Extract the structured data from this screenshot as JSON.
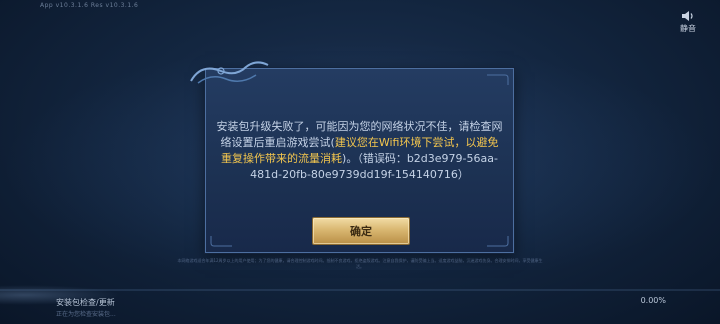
{
  "header": {
    "version": "App v10.3.1.6 Res v10.3.1.6",
    "mute_label": "静音"
  },
  "dialog": {
    "message_part1": "安装包升级失败了，可能因为您的网络状况不佳，请检查网络设置后重启游戏尝试(",
    "message_highlight": "建议您在Wifi环境下尝试，以避免重复操作带来的流量消耗",
    "message_part2": ")。（错误码：b2d3e979-56aa-481d-20fb-80e9739dd19f-154140716）",
    "confirm_label": "确定"
  },
  "footer": {
    "notice": "本网络游戏适合年满12周岁以上的用户使用；为了您的健康，请合理控制游戏时间。抵制不良游戏，拒绝盗版游戏。注意自我保护，谨防受骗上当。适度游戏益脑，沉迷游戏伤身。合理安排时间，享受健康生活。",
    "status_title": "安装包检查/更新",
    "status_sub": "正在为您检查安装包...",
    "progress_text": "0.00%",
    "progress_value": 0
  },
  "colors": {
    "highlight": "#f3c64e",
    "dialog_bg": "#1f3558",
    "button": "#d9b771"
  },
  "icons": {
    "mute": "speaker-icon"
  }
}
